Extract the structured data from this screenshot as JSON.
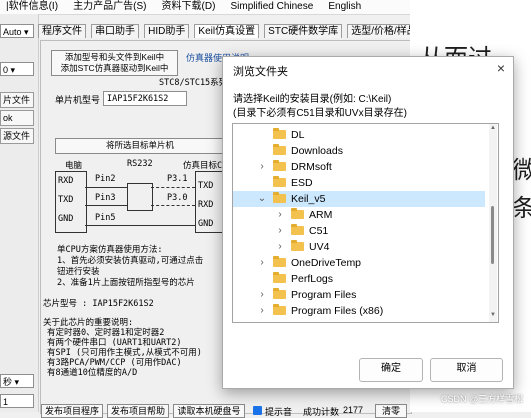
{
  "menu": [
    "|软件信息(I)",
    "主力产品广告(S)",
    "资料下载(D)",
    "Simplified Chinese",
    "English"
  ],
  "tabs": [
    "程序文件",
    "串口助手",
    "HID助手",
    "Keil仿真设置",
    "STC硬件数学库",
    "选型/价格/样品"
  ],
  "left_panel": {
    "auto_value": "Auto",
    "zero_value": "0",
    "chip_label": "片文件",
    "ok_label": "ok",
    "file_label": "源文件",
    "seconds_label": "秒",
    "speed": "1"
  },
  "keil_panel": {
    "add_button_line1": "添加型号和头文件到Keil中",
    "add_button_line2": "添加STC仿真器驱动到Keil中",
    "emulator_title": "仿真器使用说明",
    "series_text": "STC8/STC15系列",
    "chip_model_label": "单片机型号",
    "chip_model_value": "IAP15F2K61S2",
    "set_emulator_button": "将所选目标单片机",
    "diagram": {
      "pc_label": "电脑",
      "rs232_label": "RS232",
      "target_label": "仿真目标C",
      "rxd_left": "RXD",
      "txd_left": "TXD",
      "gnd_left": "GND",
      "pin2": "Pin2",
      "pin3": "Pin3",
      "pin5": "Pin5",
      "p31": "P3.1",
      "p30": "P3.0",
      "txd_right": "TXD",
      "rxd_right": "RXD",
      "gnd_right": "GND"
    },
    "method_title": "单CPU方案仿真器使用方法:",
    "method_line1": "1、首先必须安装仿真驱动,可通过点击",
    "method_line2": "钮进行安装",
    "method_line3": "2、准备1片上面按钮所指型号的芯片",
    "chip_info_label": "芯片型号 : IAP15F2K61S2",
    "notes_title": "关于此芯片的重要说明:",
    "notes": [
      "有定时器0、定时器1和定时器2",
      "有两个硬件串口 (UART1和UART2)",
      "有SPI (只可用作主模式,从模式不可用)",
      "有3路PCA/PWM/CCP (可用作DAC)",
      "有8通道10位精度的A/D"
    ],
    "bottom_buttons": [
      "发布项目程序",
      "发布项目帮助",
      "读取本机硬盘号"
    ],
    "beep_label": "提示音",
    "success_label": "成功计数",
    "success_count": "2177",
    "clear_label": "清零"
  },
  "background_chars": {
    "top_right": "从而过",
    "mid_right_1": "微",
    "mid_right_2": "条"
  },
  "dialog": {
    "title": "浏览文件夹",
    "close_glyph": "×",
    "desc_line1": "请选择Keil的安装目录(例如: C:\\Keil)",
    "desc_line2": "(目录下必须有C51目录和UVx目录存在)",
    "tree": [
      {
        "label": "DL",
        "expanded": false,
        "has_children": false,
        "selected": false,
        "indent": 1
      },
      {
        "label": "Downloads",
        "expanded": false,
        "has_children": false,
        "selected": false,
        "indent": 1
      },
      {
        "label": "DRMsoft",
        "expanded": false,
        "has_children": true,
        "selected": false,
        "indent": 1
      },
      {
        "label": "ESD",
        "expanded": false,
        "has_children": false,
        "selected": false,
        "indent": 1
      },
      {
        "label": "Keil_v5",
        "expanded": true,
        "has_children": true,
        "selected": true,
        "indent": 1
      },
      {
        "label": "ARM",
        "expanded": false,
        "has_children": true,
        "selected": false,
        "indent": 2
      },
      {
        "label": "C51",
        "expanded": false,
        "has_children": true,
        "selected": false,
        "indent": 2
      },
      {
        "label": "UV4",
        "expanded": false,
        "has_children": true,
        "selected": false,
        "indent": 2
      },
      {
        "label": "OneDriveTemp",
        "expanded": false,
        "has_children": true,
        "selected": false,
        "indent": 1
      },
      {
        "label": "PerfLogs",
        "expanded": false,
        "has_children": false,
        "selected": false,
        "indent": 1
      },
      {
        "label": "Program Files",
        "expanded": false,
        "has_children": true,
        "selected": false,
        "indent": 1
      },
      {
        "label": "Program Files (x86)",
        "expanded": false,
        "has_children": true,
        "selected": false,
        "indent": 1
      }
    ],
    "ok_label": "确定",
    "cancel_label": "取消"
  },
  "watermark": "CSDN @三方样雪松"
}
